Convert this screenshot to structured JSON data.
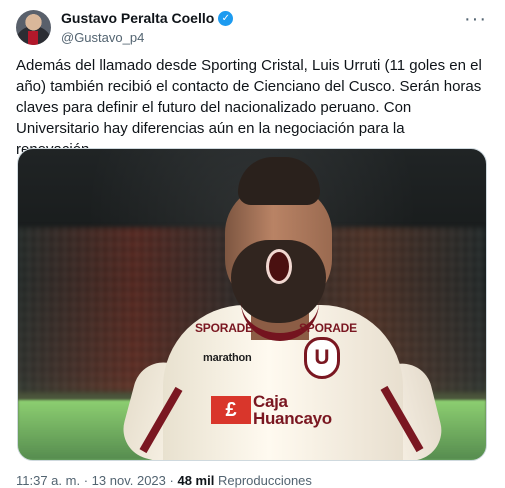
{
  "tweet": {
    "display_name": "Gustavo Peralta Coello",
    "handle": "@Gustavo_p4",
    "verified_icon": "verified-badge-icon",
    "more_icon": "more-options-icon",
    "text": "Además del llamado desde Sporting Cristal, Luis Urruti (11 goles en el año) también recibió el contacto de Cienciano del Cusco. Serán horas claves para definir el futuro del nacionalizado peruano. Con Universitario hay diferencias aún en la negociación para la renovación.",
    "time": "11:37 a. m.",
    "separator": "·",
    "date": "13 nov. 2023",
    "views_count": "48 mil",
    "views_label": "Reproducciones"
  },
  "media": {
    "sponsor_left": "SPORADE",
    "sponsor_right": "SPORADE",
    "shirt_sponsor": "marathon",
    "crest_letter": "U",
    "bank_logo": "£",
    "bank_line_1": "Caja",
    "bank_line_2": "Huancayo"
  },
  "colors": {
    "text": "#0f1419",
    "secondary": "#536471",
    "verified": "#1d9bf0",
    "border": "#cfd9de"
  }
}
